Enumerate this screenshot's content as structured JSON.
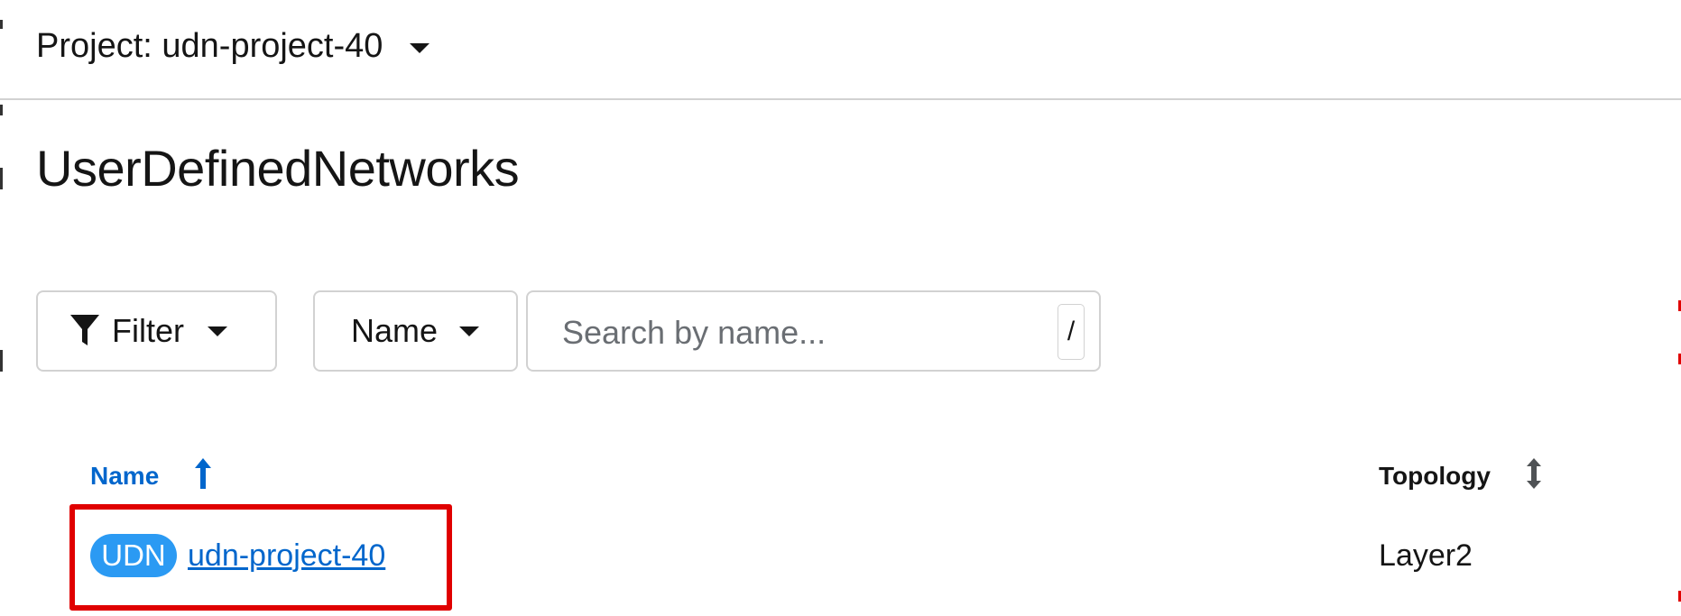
{
  "project_bar": {
    "label": "Project: udn-project-40"
  },
  "page": {
    "title": "UserDefinedNetworks"
  },
  "toolbar": {
    "filter_label": "Filter",
    "attribute_label": "Name",
    "search_placeholder": "Search by name...",
    "search_value": "",
    "shortcut_hint": "/"
  },
  "table": {
    "columns": [
      {
        "label": "Name",
        "sorted": "ascending"
      },
      {
        "label": "Topology",
        "sorted": "none"
      }
    ],
    "rows": [
      {
        "badge": "UDN",
        "name": "udn-project-40",
        "topology": "Layer2"
      }
    ]
  },
  "colors": {
    "link": "#0066cc",
    "badge_bg": "#2b9af3",
    "highlight": "#e00000",
    "border": "#d2d2d2"
  },
  "icons": {
    "filter": "funnel-icon",
    "caret": "caret-down-icon",
    "sort_active": "sort-ascending-icon",
    "sort_inactive": "sort-icon"
  }
}
